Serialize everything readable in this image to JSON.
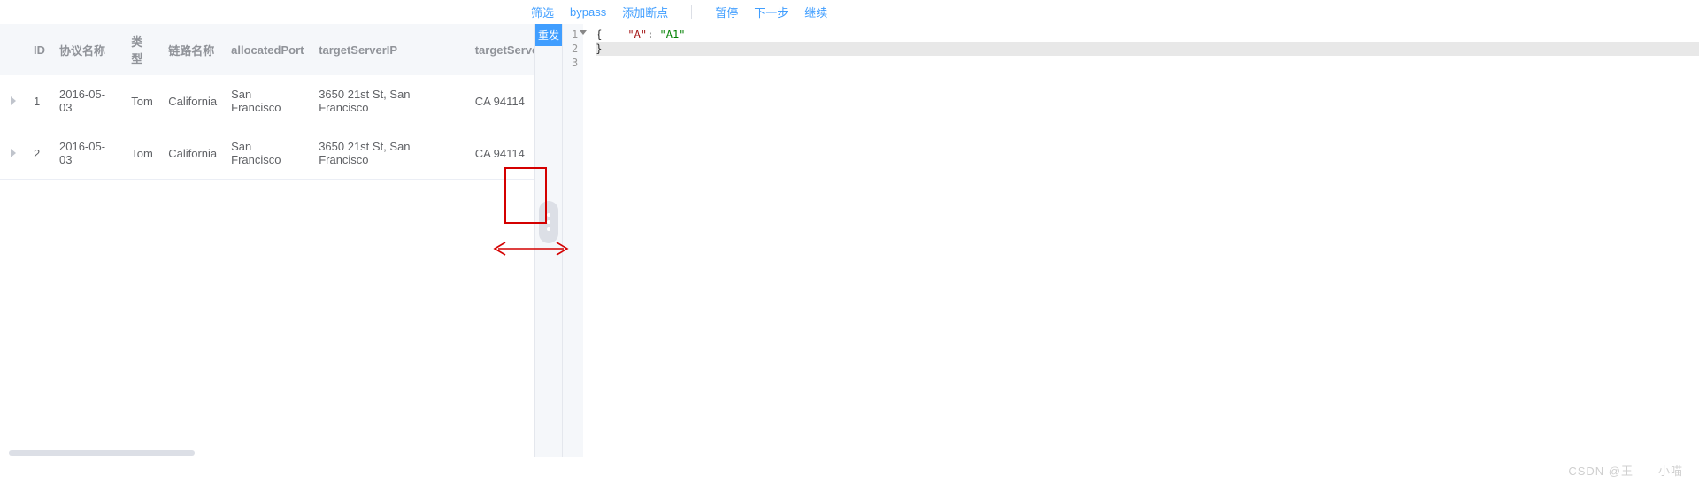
{
  "toolbar": {
    "filter": "筛选",
    "bypass": "bypass",
    "add_breakpoint": "添加断点",
    "pause": "暂停",
    "next": "下一步",
    "continue": "继续"
  },
  "resend": "重发",
  "table": {
    "headers": {
      "id": "ID",
      "protocol": "协议名称",
      "type": "类型",
      "link": "链路名称",
      "port": "allocatedPort",
      "ip": "targetServerIP",
      "p": "targetServerP"
    },
    "rows": [
      {
        "id": "1",
        "protocol": "2016-05-03",
        "type": "Tom",
        "link": "California",
        "port": "San Francisco",
        "ip": "3650 21st St, San Francisco",
        "p": "CA 94114"
      },
      {
        "id": "2",
        "protocol": "2016-05-03",
        "type": "Tom",
        "link": "California",
        "port": "San Francisco",
        "ip": "3650 21st St, San Francisco",
        "p": "CA 94114"
      }
    ]
  },
  "editor": {
    "ln1": "1",
    "ln2": "2",
    "ln3": "3",
    "line1": "{",
    "line2_key": "\"A\"",
    "line2_colon": ": ",
    "line2_val": "\"A1\"",
    "line3": "}"
  },
  "watermark": "CSDN @王——小喵"
}
